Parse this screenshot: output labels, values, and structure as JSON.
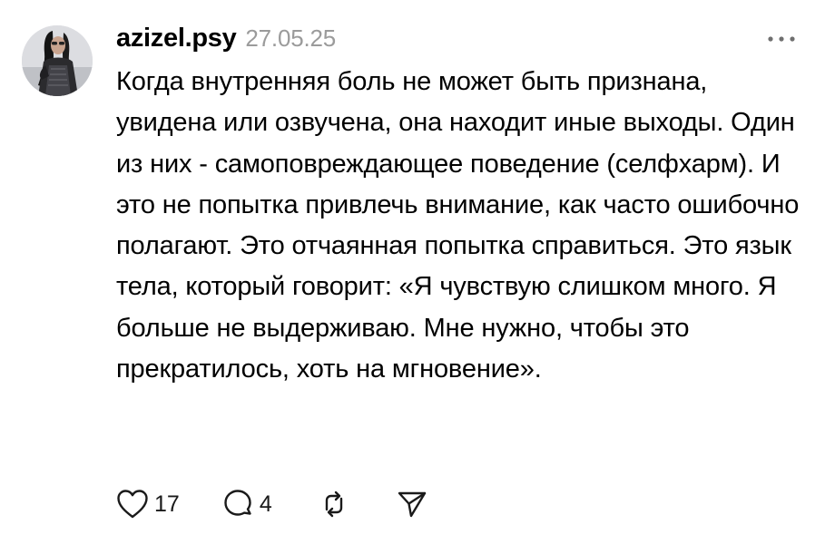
{
  "post": {
    "username": "azizel.psy",
    "timestamp": "27.05.25",
    "text": "Когда внутренняя боль не может быть признана, увидена или озвучена, она находит иные выходы. Один из них - самоповреждающее поведение (селфхарм). И это не попытка привлечь внимание, как часто ошибочно полагают. Это отчаянная попытка справиться. Это язык тела, который говорит: «Я чувствую слишком много. Я больше не выдерживаю. Мне нужно, чтобы это прекратилось, хоть на мгновение».",
    "likes_count": "17",
    "replies_count": "4"
  },
  "icons": {
    "more": "more-horizontal-icon",
    "like": "heart-icon",
    "reply": "comment-icon",
    "repost": "repost-icon",
    "share": "send-icon"
  },
  "colors": {
    "text": "#000000",
    "muted": "#9b9b9b",
    "icon": "#1a1a1a",
    "background": "#ffffff"
  }
}
